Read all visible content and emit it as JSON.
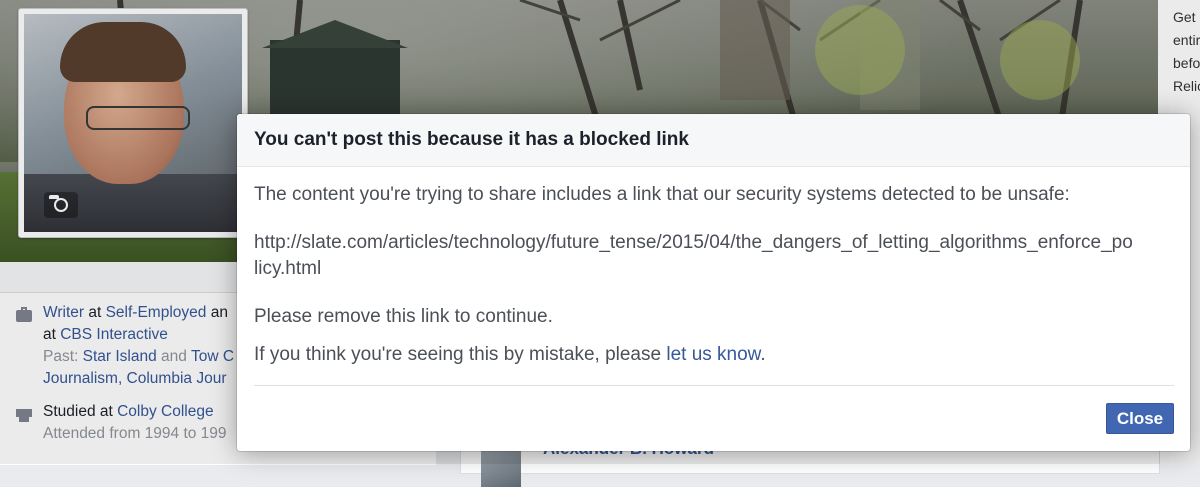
{
  "dialog": {
    "title": "You can't post this because it has a blocked link",
    "intro": "The content you're trying to share includes a link that our security systems detected to be unsafe:",
    "blocked_url": "http://slate.com/articles/technology/future_tense/2015/04/the_dangers_of_letting_algorithms_enforce_policy.html",
    "remove_text": "Please remove this link to continue.",
    "mistake_prefix": "If you think you're seeing this by mistake, please ",
    "mistake_link": "let us know",
    "mistake_suffix": ".",
    "close_label": "Close"
  },
  "intro": {
    "work_role": "Writer",
    "work_at_word": " at ",
    "work_company": "Self-Employed",
    "work_and_cut": " an",
    "work_line2_prefix": "at ",
    "work_company2": "CBS Interactive",
    "past_prefix": "Past: ",
    "past_company1": "Star Island",
    "past_and": " and ",
    "past_company2_cut": "Tow C",
    "past_company3_cut": "Journalism, Columbia Jour",
    "studied_prefix": "Studied at ",
    "studied_school": "Colby College",
    "attended_cut": "Attended from 1994 to 199"
  },
  "feed": {
    "post_author_cut": "Alexander B. Howard"
  },
  "right_ad": {
    "lines": [
      "Get",
      "entir",
      "befo",
      "Relic"
    ]
  },
  "icons": {
    "camera": "camera-icon",
    "briefcase": "briefcase-icon",
    "education": "graduation-cap-icon"
  },
  "colors": {
    "link": "#365899",
    "button": "#4267b2",
    "header_bg": "#f6f7f9"
  }
}
